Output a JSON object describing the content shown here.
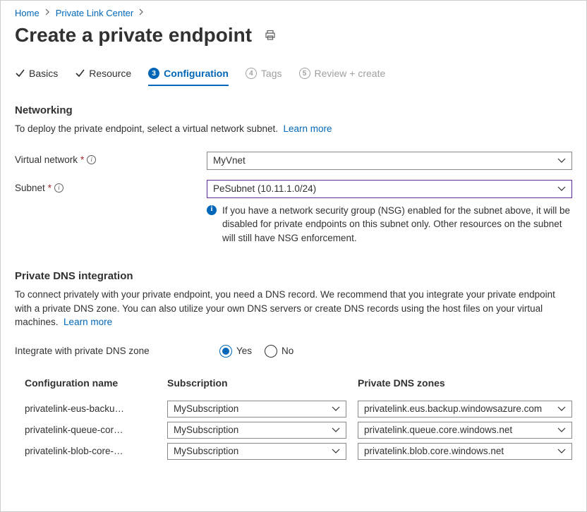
{
  "breadcrumb": {
    "home": "Home",
    "link_center": "Private Link Center"
  },
  "page_title": "Create a private endpoint",
  "tabs": {
    "basics": "Basics",
    "resource": "Resource",
    "config_num": "3",
    "configuration": "Configuration",
    "tags_num": "4",
    "tags": "Tags",
    "review_num": "5",
    "review": "Review + create"
  },
  "networking": {
    "heading": "Networking",
    "desc": "To deploy the private endpoint, select a virtual network subnet.",
    "learn_more": "Learn more",
    "vnet_label": "Virtual network",
    "vnet_value": "MyVnet",
    "subnet_label": "Subnet",
    "subnet_value": "PeSubnet (10.11.1.0/24)",
    "nsg_info": "If you have a network security group (NSG) enabled for the subnet above, it will be disabled for private endpoints on this subnet only. Other resources on the subnet will still have NSG enforcement."
  },
  "dns": {
    "heading": "Private DNS integration",
    "desc": "To connect privately with your private endpoint, you need a DNS record. We recommend that you integrate your private endpoint with a private DNS zone. You can also utilize your own DNS servers or create DNS records using the host files on your virtual machines.",
    "learn_more": "Learn more",
    "integrate_label": "Integrate with private DNS zone",
    "yes": "Yes",
    "no": "No",
    "col_config": "Configuration name",
    "col_sub": "Subscription",
    "col_zone": "Private DNS zones",
    "rows": [
      {
        "name": "privatelink-eus-backu…",
        "sub": "MySubscription",
        "zone": "privatelink.eus.backup.windowsazure.com"
      },
      {
        "name": "privatelink-queue-cor…",
        "sub": "MySubscription",
        "zone": "privatelink.queue.core.windows.net"
      },
      {
        "name": "privatelink-blob-core-…",
        "sub": "MySubscription",
        "zone": "privatelink.blob.core.windows.net"
      }
    ]
  }
}
